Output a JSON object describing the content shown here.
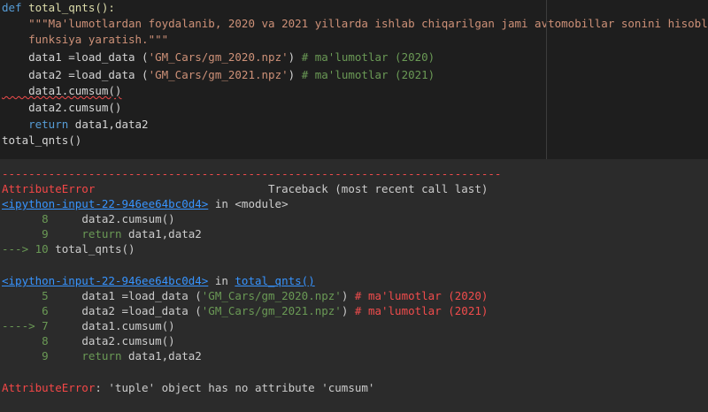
{
  "code": {
    "l1_def": "def",
    "l1_name": " total_qnts():",
    "l2": "    \"\"\"Ma'lumotlardan foydalanib, 2020 va 2021 yillarda ishlab chiqarilgan jami avtomobillar sonini hisoblovchi",
    "l3": "    funksiya yaratish.\"\"\"",
    "l4_a": "    data1 =load_data (",
    "l4_str": "'GM_Cars/gm_2020.npz'",
    "l4_b": ") ",
    "l4_cm": "# ma'lumotlar (2020)",
    "l5_a": "    data2 =load_data (",
    "l5_str": "'GM_Cars/gm_2021.npz'",
    "l5_b": ") ",
    "l5_cm": "# ma'lumotlar (2021)",
    "l6": "    data1.cumsum()",
    "l7": "    data2.cumsum()",
    "l8_kw": "    return",
    "l8_rest": " data1,data2",
    "l9": "total_qnts()"
  },
  "output": {
    "dashes": "---------------------------------------------------------------------------",
    "err_name": "AttributeError",
    "traceback_label": "                          Traceback (most recent call last)",
    "frame1_link": "<ipython-input-22-946ee64bc0d4>",
    "frame1_in": " in ",
    "frame1_mod": "<module>",
    "f1_n8": "      8",
    "f1_c8": "     data2.cumsum()",
    "f1_n9": "      9",
    "f1_c9_kw": "     return",
    "f1_c9_rest": " data1,data2",
    "f1_arrow": "---> 10",
    "f1_c10": " total_qnts()",
    "frame2_link": "<ipython-input-22-946ee64bc0d4>",
    "frame2_in": " in ",
    "frame2_fn": "total_qnts()",
    "f2_n5": "      5",
    "f2_c5_a": "     data1 =load_data (",
    "f2_c5_str": "'GM_Cars/gm_2020.npz'",
    "f2_c5_b": ") ",
    "f2_c5_cm": "# ma'lumotlar (2020)",
    "f2_n6": "      6",
    "f2_c6_a": "     data2 =load_data (",
    "f2_c6_str": "'GM_Cars/gm_2021.npz'",
    "f2_c6_b": ") ",
    "f2_c6_cm": "# ma'lumotlar (2021)",
    "f2_arrow": "----> 7",
    "f2_c7": "     data1.cumsum()",
    "f2_n8": "      8",
    "f2_c8": "     data2.cumsum()",
    "f2_n9": "      9",
    "f2_c9_kw": "     return",
    "f2_c9_rest": " data1,data2",
    "final_err": "AttributeError",
    "final_msg": ": 'tuple' object has no attribute 'cumsum'"
  }
}
